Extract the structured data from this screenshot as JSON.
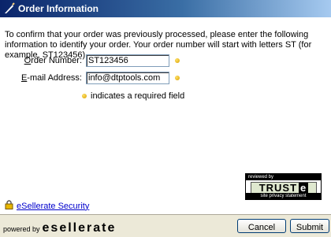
{
  "window": {
    "title": "Order Information",
    "title_icon": "quill-icon"
  },
  "form": {
    "intro": "To confirm that your order was previously processed, please enter the following information to identify your order. Your order number will start with letters ST (for example, ST123456).",
    "order_number": {
      "label_first": "O",
      "label_rest": "rder Number:",
      "value": "ST123456"
    },
    "email": {
      "label_first": "E",
      "label_rest": "-mail Address:",
      "value": "info@dtptools.com"
    },
    "required_note": "indicates a required field"
  },
  "trust": {
    "reviewed": "reviewed by",
    "logo": "TRUST",
    "logo_e": "e",
    "statement": "site privacy statement"
  },
  "security_link": "eSellerate Security",
  "footer": {
    "powered_by": "powered by",
    "brand": "esellerate",
    "cancel_label": "Cancel",
    "submit_label": "Submit"
  },
  "colors": {
    "title_gradient_start": "#0a246a",
    "link": "#0000cc",
    "required_dot": "#f0b800"
  }
}
